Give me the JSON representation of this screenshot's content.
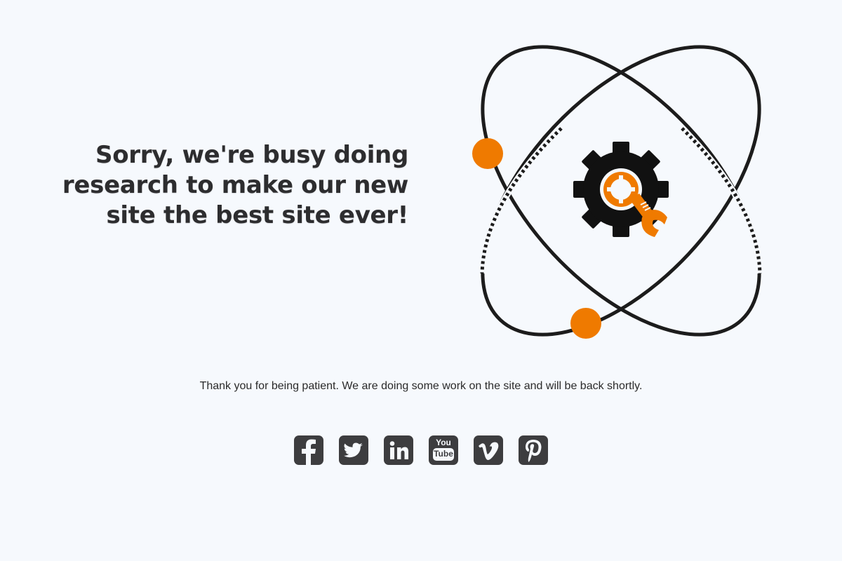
{
  "headline": {
    "line1": "Sorry, we're busy doing",
    "line2": "research to make our new",
    "line3": "site the best site ever!"
  },
  "message": "Thank you for being patient. We are doing some work on the site and will be back shortly.",
  "illustration": {
    "icon": "atom-gear-wrench-illustration",
    "accent_color": "#ef7a00",
    "line_color": "#1c1c1c"
  },
  "social": [
    {
      "name": "facebook",
      "icon": "facebook-icon"
    },
    {
      "name": "twitter",
      "icon": "twitter-icon"
    },
    {
      "name": "linkedin",
      "icon": "linkedin-icon",
      "label": "in"
    },
    {
      "name": "youtube",
      "icon": "youtube-icon",
      "label_top": "You",
      "label_bottom": "Tube"
    },
    {
      "name": "vimeo",
      "icon": "vimeo-icon"
    },
    {
      "name": "pinterest",
      "icon": "pinterest-icon"
    }
  ],
  "colors": {
    "background": "#f6f9fd",
    "text": "#2d2d2f",
    "icon_bg": "#3d3d3f"
  }
}
